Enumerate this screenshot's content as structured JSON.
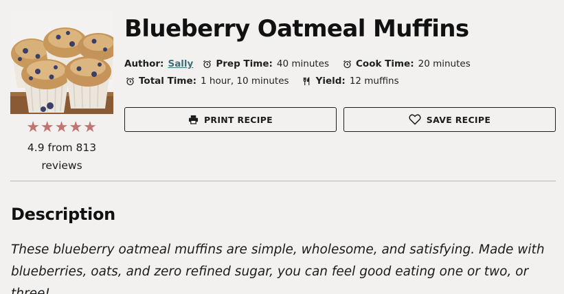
{
  "recipe": {
    "title": "Blueberry Oatmeal Muffins",
    "image_alt": "blueberry oatmeal muffins photo"
  },
  "rating": {
    "stars": "★★★★★",
    "star_color": "#c0766f",
    "summary": "4.9 from 813 reviews"
  },
  "meta": {
    "author_label": "Author:",
    "author_name": "Sally",
    "prep_label": "Prep Time:",
    "prep_value": "40 minutes",
    "cook_label": "Cook Time:",
    "cook_value": "20 minutes",
    "total_label": "Total Time:",
    "total_value": "1 hour, 10 minutes",
    "yield_label": "Yield:",
    "yield_value": "12 muffins",
    "icons": [
      "alarm-clock-icon",
      "alarm-clock-icon",
      "alarm-clock-icon",
      "fork-knife-icon"
    ]
  },
  "actions": {
    "print_label": "PRINT RECIPE",
    "print_icon": "printer-icon",
    "save_label": "SAVE RECIPE",
    "save_icon": "heart-icon"
  },
  "description": {
    "heading": "Description",
    "text": "These blueberry oatmeal muffins are simple, wholesome, and satisfying. Made with blueberries, oats, and zero refined sugar, you can feel good eating one or two, or three!"
  },
  "colors": {
    "background": "#f2f1f0",
    "link": "#3e6f74",
    "divider": "#b9b7b4"
  }
}
